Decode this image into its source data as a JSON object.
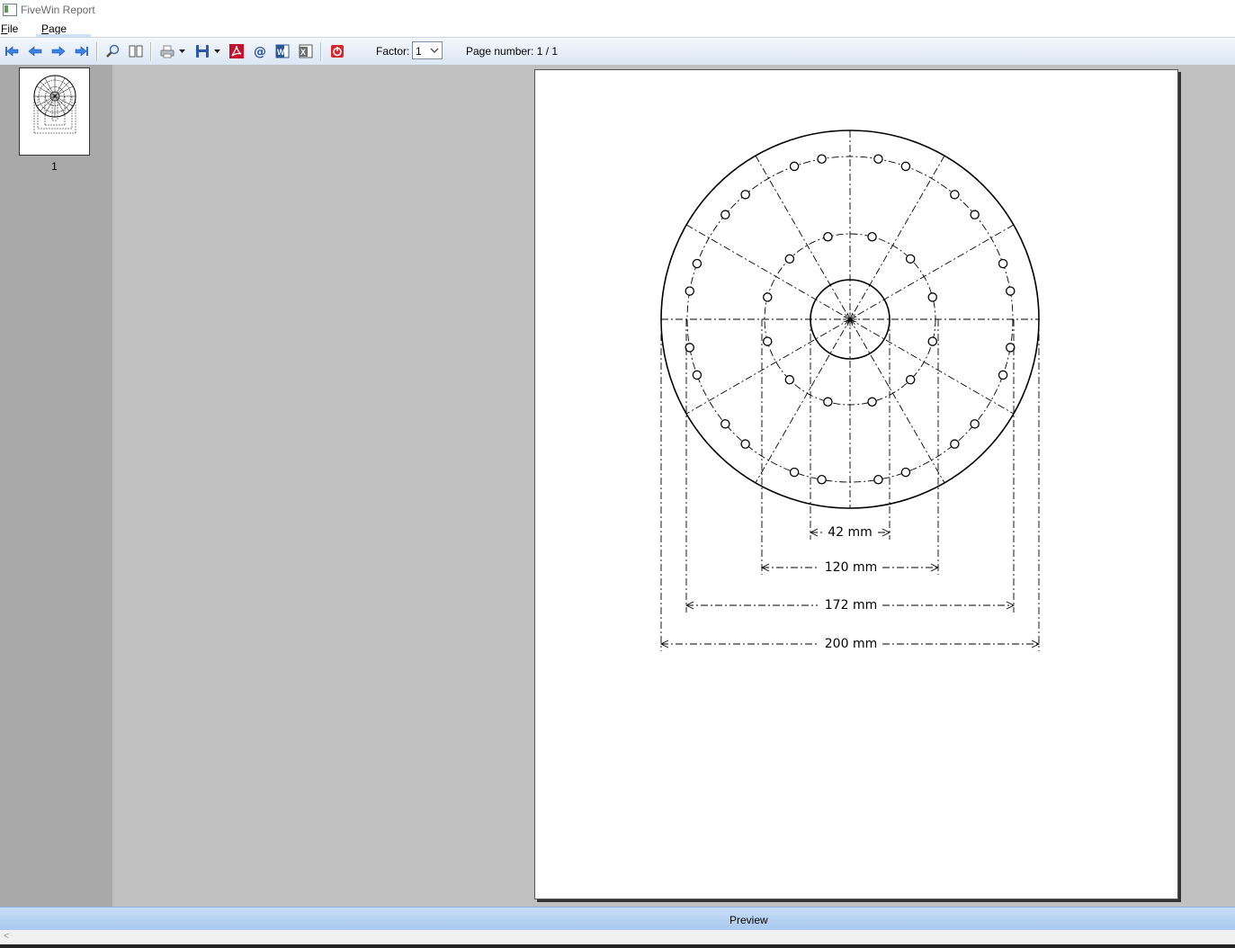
{
  "window": {
    "title": "FiveWin Report"
  },
  "menu": {
    "items": [
      "File",
      "Page"
    ]
  },
  "toolbar": {
    "factor_label": "Factor:",
    "factor_value": "1",
    "page_number": "Page number: 1 / 1",
    "icons": [
      "first-page-icon",
      "previous-page-icon",
      "next-page-icon",
      "last-page-icon",
      "zoom-icon",
      "two-pages-icon",
      "print-icon",
      "dropdown-icon",
      "save-icon",
      "dropdown-icon",
      "pdf-icon",
      "email-icon",
      "word-icon",
      "excel-icon",
      "exit-icon"
    ]
  },
  "thumbnails": [
    {
      "label": "1"
    }
  ],
  "drawing": {
    "dimensions": [
      "42 mm",
      "120 mm",
      "172 mm",
      "200 mm"
    ]
  },
  "status": {
    "text": "Preview"
  },
  "colors": {
    "toolbar": "#dbe6f4",
    "statusbar": "#b6d3f2",
    "panel": "#a9a9a9",
    "workspace": "#c0c0c0",
    "pdf": "#c8102e",
    "exit": "#d9262c"
  }
}
